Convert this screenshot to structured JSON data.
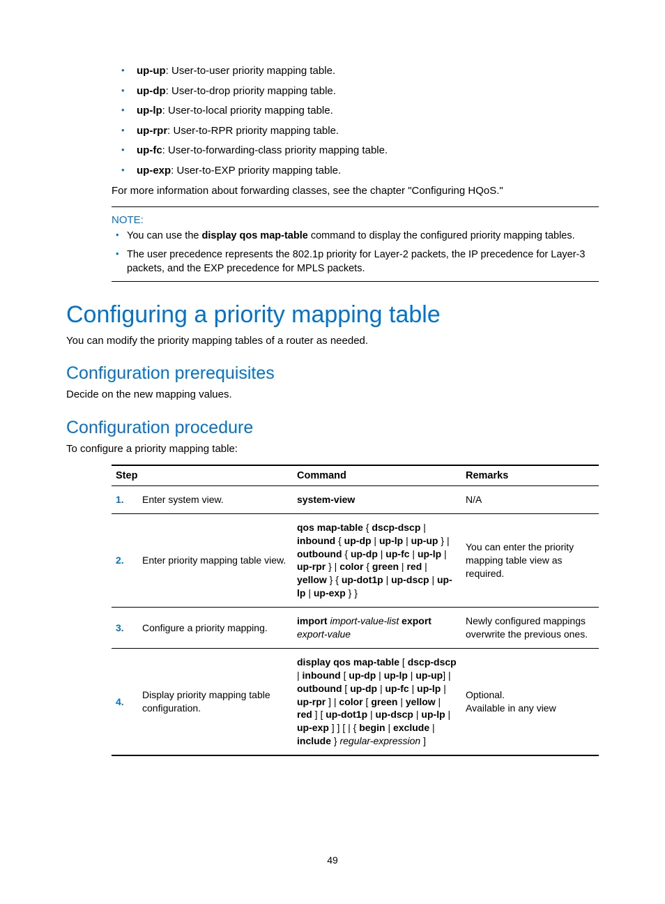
{
  "definitions": [
    {
      "term": "up-up",
      "desc": ": User-to-user priority mapping table."
    },
    {
      "term": "up-dp",
      "desc": ": User-to-drop priority mapping table."
    },
    {
      "term": "up-lp",
      "desc": ": User-to-local priority mapping table."
    },
    {
      "term": "up-rpr",
      "desc": ": User-to-RPR priority mapping table."
    },
    {
      "term": "up-fc",
      "desc": ": User-to-forwarding-class priority mapping table."
    },
    {
      "term": "up-exp",
      "desc": ": User-to-EXP priority mapping table."
    }
  ],
  "intro_para": "For more information about forwarding classes, see the chapter \"Configuring HQoS.\"",
  "note": {
    "label": "NOTE:",
    "items": [
      {
        "pre": "You can use the ",
        "bold": "display qos map-table",
        "post": " command to display the configured priority mapping tables."
      },
      {
        "pre": "The user precedence represents the 802.1p priority for Layer-2 packets, the IP precedence for Layer-3 packets, and the EXP precedence for MPLS packets.",
        "bold": "",
        "post": ""
      }
    ]
  },
  "h1": "Configuring a priority mapping table",
  "h1_para": "You can modify the priority mapping tables of a router as needed.",
  "h2a": "Configuration prerequisites",
  "h2a_para": "Decide on the new mapping values.",
  "h2b": "Configuration procedure",
  "h2b_para": "To configure a priority mapping table:",
  "table": {
    "headers": {
      "step": "Step",
      "cmd": "Command",
      "rem": "Remarks"
    },
    "rows": [
      {
        "num": "1.",
        "step": "Enter system view.",
        "cmd_html": "<span class='cmd-bold'>system-view</span>",
        "rem_html": "N/A"
      },
      {
        "num": "2.",
        "step": "Enter priority mapping table view.",
        "cmd_html": "<span class='cmd-bold'>qos map-table</span> { <span class='cmd-bold'>dscp-dscp</span> | <span class='cmd-bold'>inbound</span> { <span class='cmd-bold'>up-dp</span> | <span class='cmd-bold'>up-lp</span> | <span class='cmd-bold'>up-up</span> } | <span class='cmd-bold'>outbound</span> { <span class='cmd-bold'>up-dp</span> | <span class='cmd-bold'>up-fc</span> | <span class='cmd-bold'>up-lp</span> | <span class='cmd-bold'>up-rpr</span> } | <span class='cmd-bold'>color</span> { <span class='cmd-bold'>green</span> | <span class='cmd-bold'>red</span> | <span class='cmd-bold'>yellow</span> } { <span class='cmd-bold'>up-dot1p</span> | <span class='cmd-bold'>up-dscp</span> | <span class='cmd-bold'>up-lp</span> | <span class='cmd-bold'>up-exp</span> } }",
        "rem_html": "You can enter the priority mapping table view as required."
      },
      {
        "num": "3.",
        "step": "Configure a priority mapping.",
        "cmd_html": "<span class='cmd-bold'>import</span> <span class='cmd-ital'>import-value-list</span> <span class='cmd-bold'>export</span> <span class='cmd-ital'>export-value</span>",
        "rem_html": "Newly configured mappings overwrite the previous ones."
      },
      {
        "num": "4.",
        "step": "Display priority mapping table configuration.",
        "cmd_html": "<span class='cmd-bold'>display qos map-table</span> [ <span class='cmd-bold'>dscp-dscp</span> | <span class='cmd-bold'>inbound</span> [ <span class='cmd-bold'>up-dp</span> | <span class='cmd-bold'>up-lp</span> | <span class='cmd-bold'>up-up</span>] | <span class='cmd-bold'>outbound</span> [ <span class='cmd-bold'>up-dp</span> | <span class='cmd-bold'>up-fc</span> | <span class='cmd-bold'>up-lp</span> | <span class='cmd-bold'>up-rpr</span> ] | <span class='cmd-bold'>color</span> [ <span class='cmd-bold'>green</span> | <span class='cmd-bold'>yellow</span> | <span class='cmd-bold'>red</span> ] [ <span class='cmd-bold'>up-dot1p</span> | <span class='cmd-bold'>up-dscp</span> | <span class='cmd-bold'>up-lp</span> | <span class='cmd-bold'>up-exp</span> ] ] [ | { <span class='cmd-bold'>begin</span> | <span class='cmd-bold'>exclude</span> | <span class='cmd-bold'>include</span> } <span class='cmd-ital'>regular-expression</span> ]",
        "rem_html": "Optional.<br>Available in any view"
      }
    ]
  },
  "page_number": "49"
}
